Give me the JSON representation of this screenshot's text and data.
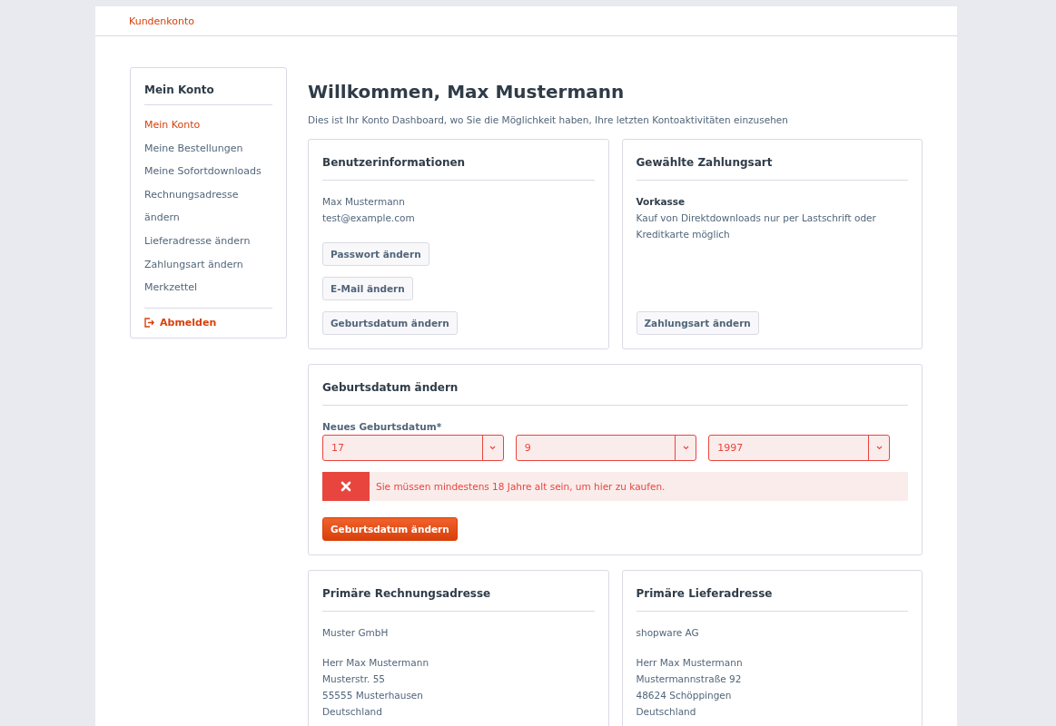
{
  "header": {
    "breadcrumb": "Kundenkonto"
  },
  "sidebar": {
    "title": "Mein Konto",
    "items": [
      {
        "label": "Mein Konto",
        "selected": true
      },
      {
        "label": "Meine Bestellungen",
        "selected": false
      },
      {
        "label": "Meine Sofortdownloads",
        "selected": false
      },
      {
        "label": "Rechnungsadresse ändern",
        "selected": false
      },
      {
        "label": "Lieferadresse ändern",
        "selected": false
      },
      {
        "label": "Zahlungsart ändern",
        "selected": false
      },
      {
        "label": "Merkzettel",
        "selected": false
      }
    ],
    "logout": "Abmelden"
  },
  "main": {
    "title": "Willkommen, Max Mustermann",
    "description": "Dies ist Ihr Konto Dashboard, wo Sie die Möglichkeit haben, Ihre letzten Kontoaktivitäten einzusehen"
  },
  "user_info": {
    "title": "Benutzerinformationen",
    "lines": [
      "Max Mustermann",
      "test@example.com"
    ],
    "buttons": [
      "Passwort ändern",
      "E-Mail ändern",
      "Geburtsdatum ändern"
    ]
  },
  "payment": {
    "title": "Gewählte Zahlungsart",
    "method": "Vorkasse",
    "note": "Kauf von Direktdownloads nur per Lastschrift oder Kreditkarte möglich",
    "button": "Zahlungsart ändern"
  },
  "birthday_form": {
    "title": "Geburtsdatum ändern",
    "label": "Neues Geburtsdatum*",
    "invalid": true,
    "selects": [
      "17",
      "9",
      "1997"
    ],
    "error_message": "Sie müssen mindestens 18 Jahre alt sein, um hier zu kaufen.",
    "submit": "Geburtsdatum ändern"
  },
  "addresses": [
    {
      "title": "Primäre Rechnungsadresse",
      "company": "Muster GmbH",
      "lines": [
        "Herr Max Mustermann",
        "Musterstr. 55",
        "55555 Musterhausen",
        "Deutschland"
      ]
    },
    {
      "title": "Primäre Lieferadresse",
      "company": "shopware AG",
      "lines": [
        "Herr Max Mustermann",
        "Mustermannstraße 92",
        "48624 Schöppingen",
        "Deutschland"
      ]
    }
  ]
}
